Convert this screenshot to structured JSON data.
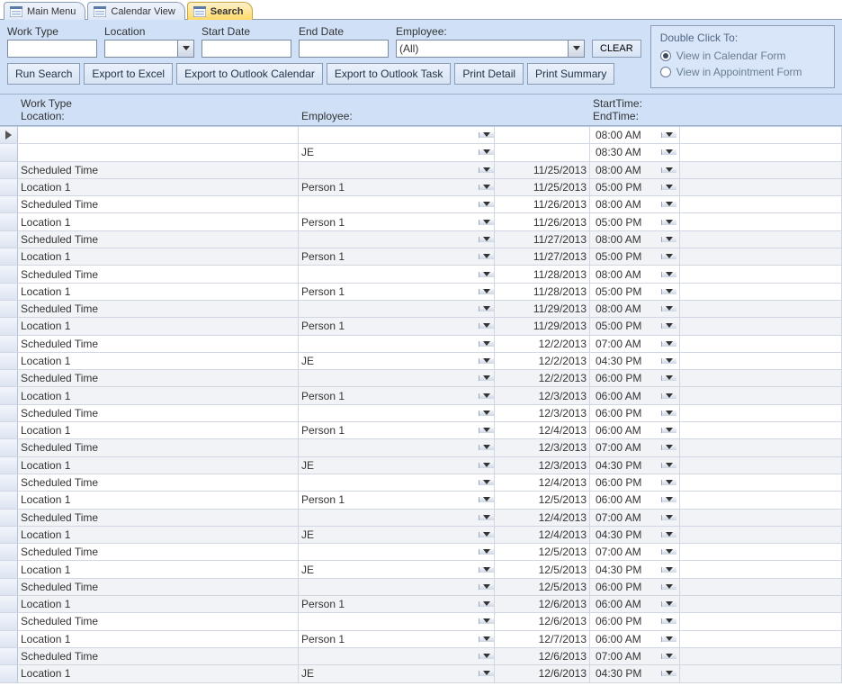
{
  "tabs": [
    {
      "label": "Main Menu",
      "active": false
    },
    {
      "label": "Calendar View",
      "active": false
    },
    {
      "label": "Search",
      "active": true
    }
  ],
  "filters": {
    "workType": {
      "label": "Work Type",
      "value": ""
    },
    "location": {
      "label": "Location",
      "value": ""
    },
    "startDate": {
      "label": "Start Date",
      "value": ""
    },
    "endDate": {
      "label": "End Date",
      "value": ""
    },
    "employee": {
      "label": "Employee:",
      "value": "(All)"
    },
    "clear": "CLEAR"
  },
  "buttons": {
    "run": "Run Search",
    "excel": "Export to Excel",
    "outlookCal": "Export to Outlook Calendar",
    "outlookTask": "Export to Outlook Task",
    "printDetail": "Print Detail",
    "printSummary": "Print Summary"
  },
  "sidebox": {
    "title": "Double Click To:",
    "opt1": "View in Calendar Form",
    "opt2": "View in Appointment Form",
    "selected": "opt1"
  },
  "detailHeader": {
    "workType": "Work Type",
    "location": "Location:",
    "employee": "Employee:",
    "start": "StartTime:",
    "end": "EndTime:"
  },
  "rows": [
    {
      "sel": true,
      "workType": "",
      "location": "",
      "employee": "",
      "date": "",
      "time": "08:00 AM"
    },
    {
      "sel": false,
      "workType": "",
      "location": "",
      "employee": "JE",
      "date": "",
      "time": "08:30 AM"
    },
    {
      "sel": false,
      "workType": "Scheduled Time",
      "location": "",
      "employee": "",
      "date": "11/25/2013",
      "time": "08:00 AM"
    },
    {
      "sel": false,
      "workType": "",
      "location": "Location 1",
      "employee": "Person 1",
      "date": "11/25/2013",
      "time": "05:00 PM"
    },
    {
      "sel": false,
      "workType": "Scheduled Time",
      "location": "",
      "employee": "",
      "date": "11/26/2013",
      "time": "08:00 AM"
    },
    {
      "sel": false,
      "workType": "",
      "location": "Location 1",
      "employee": "Person 1",
      "date": "11/26/2013",
      "time": "05:00 PM"
    },
    {
      "sel": false,
      "workType": "Scheduled Time",
      "location": "",
      "employee": "",
      "date": "11/27/2013",
      "time": "08:00 AM"
    },
    {
      "sel": false,
      "workType": "",
      "location": "Location 1",
      "employee": "Person 1",
      "date": "11/27/2013",
      "time": "05:00 PM"
    },
    {
      "sel": false,
      "workType": "Scheduled Time",
      "location": "",
      "employee": "",
      "date": "11/28/2013",
      "time": "08:00 AM"
    },
    {
      "sel": false,
      "workType": "",
      "location": "Location 1",
      "employee": "Person 1",
      "date": "11/28/2013",
      "time": "05:00 PM"
    },
    {
      "sel": false,
      "workType": "Scheduled Time",
      "location": "",
      "employee": "",
      "date": "11/29/2013",
      "time": "08:00 AM"
    },
    {
      "sel": false,
      "workType": "",
      "location": "Location 1",
      "employee": "Person 1",
      "date": "11/29/2013",
      "time": "05:00 PM"
    },
    {
      "sel": false,
      "workType": "Scheduled Time",
      "location": "",
      "employee": "",
      "date": "12/2/2013",
      "time": "07:00 AM"
    },
    {
      "sel": false,
      "workType": "",
      "location": "Location 1",
      "employee": "JE",
      "date": "12/2/2013",
      "time": "04:30 PM"
    },
    {
      "sel": false,
      "workType": "Scheduled Time",
      "location": "",
      "employee": "",
      "date": "12/2/2013",
      "time": "06:00 PM"
    },
    {
      "sel": false,
      "workType": "",
      "location": "Location 1",
      "employee": "Person 1",
      "date": "12/3/2013",
      "time": "06:00 AM"
    },
    {
      "sel": false,
      "workType": "Scheduled Time",
      "location": "",
      "employee": "",
      "date": "12/3/2013",
      "time": "06:00 PM"
    },
    {
      "sel": false,
      "workType": "",
      "location": "Location 1",
      "employee": "Person 1",
      "date": "12/4/2013",
      "time": "06:00 AM"
    },
    {
      "sel": false,
      "workType": "Scheduled Time",
      "location": "",
      "employee": "",
      "date": "12/3/2013",
      "time": "07:00 AM"
    },
    {
      "sel": false,
      "workType": "",
      "location": "Location 1",
      "employee": "JE",
      "date": "12/3/2013",
      "time": "04:30 PM"
    },
    {
      "sel": false,
      "workType": "Scheduled Time",
      "location": "",
      "employee": "",
      "date": "12/4/2013",
      "time": "06:00 PM"
    },
    {
      "sel": false,
      "workType": "",
      "location": "Location 1",
      "employee": "Person 1",
      "date": "12/5/2013",
      "time": "06:00 AM"
    },
    {
      "sel": false,
      "workType": "Scheduled Time",
      "location": "",
      "employee": "",
      "date": "12/4/2013",
      "time": "07:00 AM"
    },
    {
      "sel": false,
      "workType": "",
      "location": "Location 1",
      "employee": "JE",
      "date": "12/4/2013",
      "time": "04:30 PM"
    },
    {
      "sel": false,
      "workType": "Scheduled Time",
      "location": "",
      "employee": "",
      "date": "12/5/2013",
      "time": "07:00 AM"
    },
    {
      "sel": false,
      "workType": "",
      "location": "Location 1",
      "employee": "JE",
      "date": "12/5/2013",
      "time": "04:30 PM"
    },
    {
      "sel": false,
      "workType": "Scheduled Time",
      "location": "",
      "employee": "",
      "date": "12/5/2013",
      "time": "06:00 PM"
    },
    {
      "sel": false,
      "workType": "",
      "location": "Location 1",
      "employee": "Person 1",
      "date": "12/6/2013",
      "time": "06:00 AM"
    },
    {
      "sel": false,
      "workType": "Scheduled Time",
      "location": "",
      "employee": "",
      "date": "12/6/2013",
      "time": "06:00 PM"
    },
    {
      "sel": false,
      "workType": "",
      "location": "Location 1",
      "employee": "Person 1",
      "date": "12/7/2013",
      "time": "06:00 AM"
    },
    {
      "sel": false,
      "workType": "Scheduled Time",
      "location": "",
      "employee": "",
      "date": "12/6/2013",
      "time": "07:00 AM"
    },
    {
      "sel": false,
      "workType": "",
      "location": "Location 1",
      "employee": "JE",
      "date": "12/6/2013",
      "time": "04:30 PM"
    }
  ]
}
